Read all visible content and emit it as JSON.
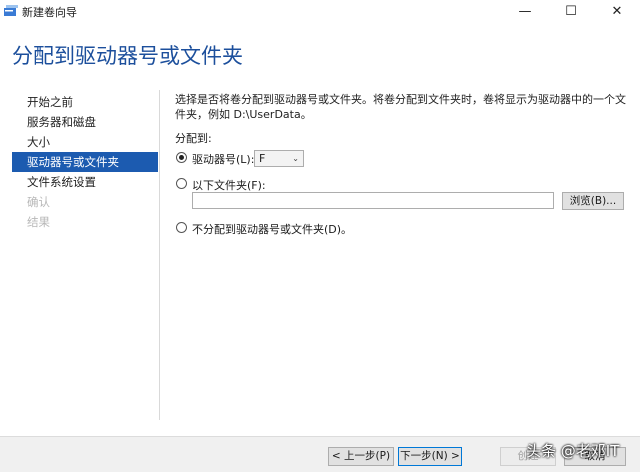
{
  "window": {
    "title": "新建卷向导",
    "minimize_glyph": "—",
    "maximize_glyph": "☐",
    "close_glyph": "✕"
  },
  "page": {
    "heading": "分配到驱动器号或文件夹"
  },
  "nav": {
    "items": [
      {
        "label": "开始之前",
        "state": "normal"
      },
      {
        "label": "服务器和磁盘",
        "state": "normal"
      },
      {
        "label": "大小",
        "state": "normal"
      },
      {
        "label": "驱动器号或文件夹",
        "state": "active"
      },
      {
        "label": "文件系统设置",
        "state": "normal"
      },
      {
        "label": "确认",
        "state": "disabled"
      },
      {
        "label": "结果",
        "state": "disabled"
      }
    ]
  },
  "content": {
    "description": "选择是否将卷分配到驱动器号或文件夹。将卷分配到文件夹时，卷将显示为驱动器中的一个文件夹，例如 D:\\UserData。",
    "assign_label": "分配到:",
    "options": {
      "drive_letter": {
        "label": "驱动器号(L):",
        "checked": true,
        "value": "F"
      },
      "folder": {
        "label": "以下文件夹(F):",
        "checked": false,
        "value": "",
        "browse_label": "浏览(B)..."
      },
      "none": {
        "label": "不分配到驱动器号或文件夹(D)。",
        "checked": false
      }
    }
  },
  "footer": {
    "prev_label": "< 上一步(P)",
    "next_label": "下一步(N) >",
    "create_label": "创建",
    "cancel_label": "取消"
  },
  "watermark": "头条 @老邓IT",
  "colors": {
    "heading": "#1c4f9c",
    "active_nav": "#1c5bb0"
  }
}
